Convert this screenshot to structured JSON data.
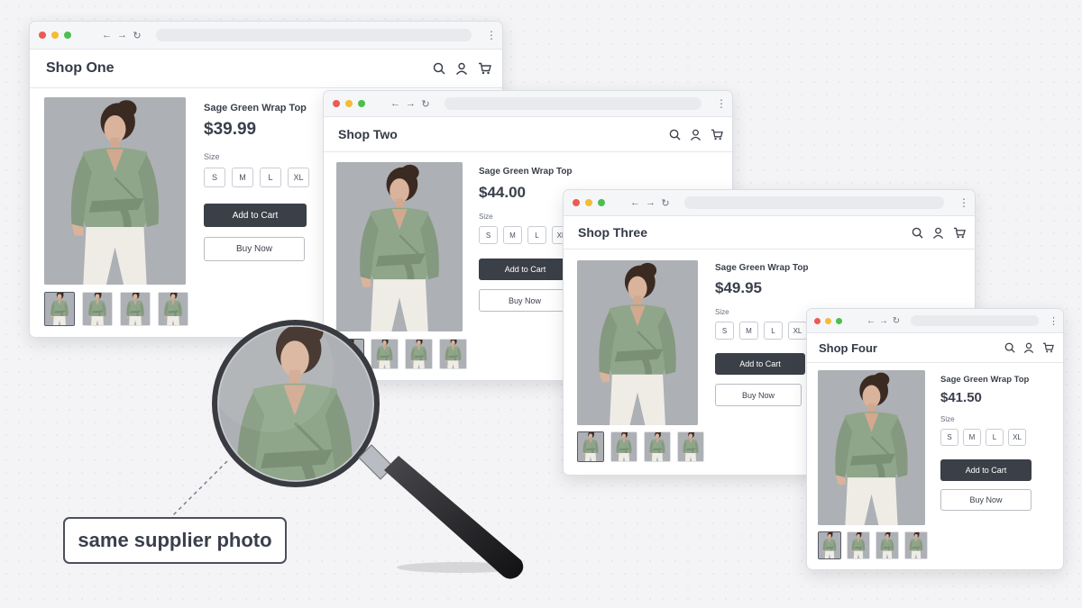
{
  "windows": [
    {
      "shop_name": "Shop One",
      "product_title": "Sage Green Wrap Top",
      "price": "$39.99",
      "size_label": "Size",
      "sizes": [
        "S",
        "M",
        "L",
        "XL"
      ],
      "add_to_cart": "Add to Cart",
      "buy_now": "Buy Now"
    },
    {
      "shop_name": "Shop Two",
      "product_title": "Sage Green Wrap Top",
      "price": "$44.00",
      "size_label": "Size",
      "sizes": [
        "S",
        "M",
        "L",
        "XL"
      ],
      "add_to_cart": "Add to Cart",
      "buy_now": "Buy Now"
    },
    {
      "shop_name": "Shop Three",
      "product_title": "Sage Green Wrap Top",
      "price": "$49.95",
      "size_label": "Size",
      "sizes": [
        "S",
        "M",
        "L",
        "XL"
      ],
      "add_to_cart": "Add to Cart",
      "buy_now": "Buy Now"
    },
    {
      "shop_name": "Shop Four",
      "product_title": "Sage Green Wrap Top",
      "price": "$41.50",
      "size_label": "Size",
      "sizes": [
        "S",
        "M",
        "L",
        "XL"
      ],
      "add_to_cart": "Add to Cart",
      "buy_now": "Buy Now"
    }
  ],
  "callout": {
    "text": "same supplier photo"
  },
  "icons": [
    "back-arrow-icon",
    "forward-arrow-icon",
    "reload-icon",
    "more-menu-icon",
    "search-icon",
    "user-icon",
    "cart-icon",
    "magnifying-glass-icon"
  ],
  "colors": {
    "blouse": "#8fa68a",
    "primary_button": "#3b3f48",
    "close_dot": "#ec5b57",
    "minimize_dot": "#f4bb35",
    "maximize_dot": "#4cbf4d"
  }
}
